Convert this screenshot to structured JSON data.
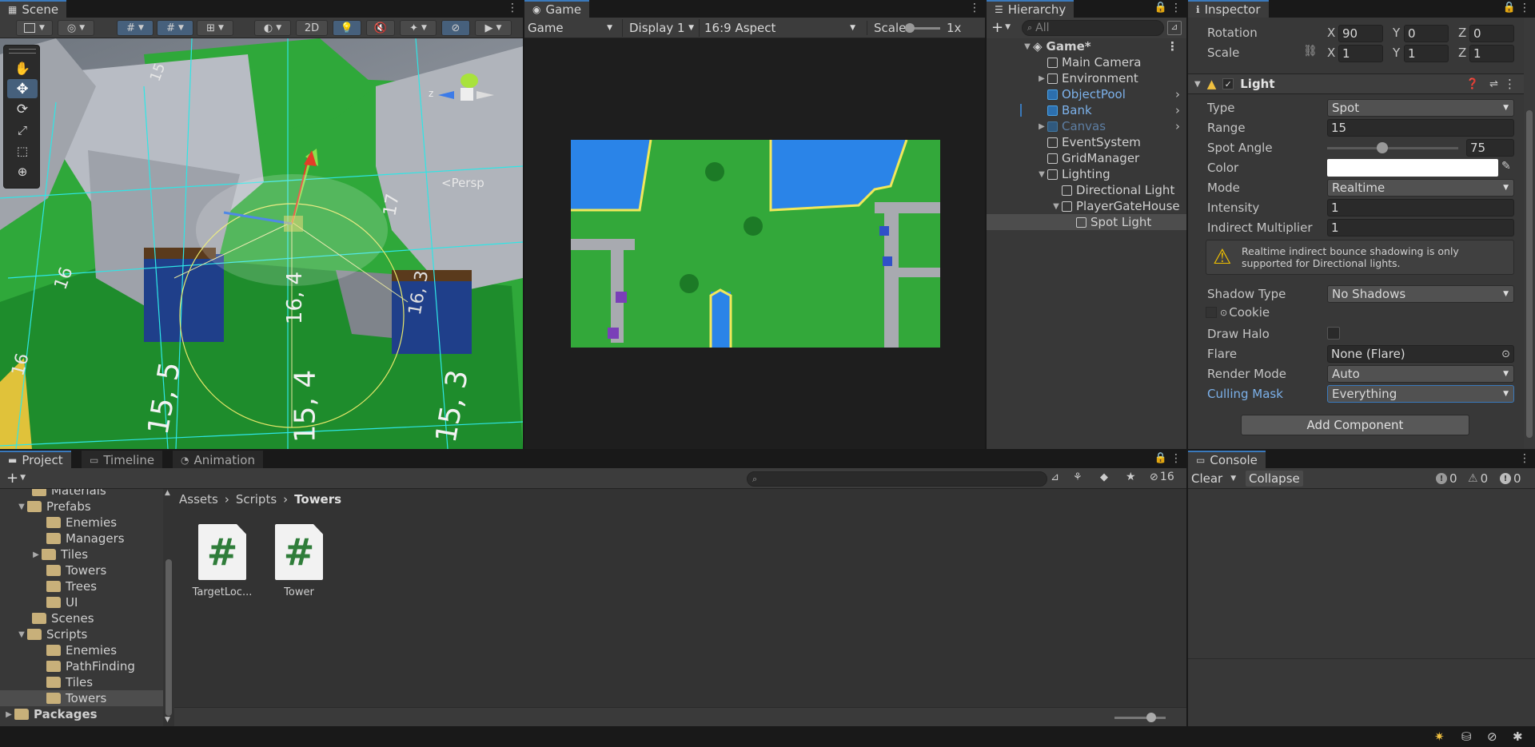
{
  "scene": {
    "tab_label": "Scene",
    "mode_2d": "2D",
    "persp_label": "<Persp",
    "axis_z": "z",
    "grid_labels": [
      "16",
      "16, 4",
      "17",
      "16, 3",
      "15, 5",
      "15, 4",
      "15, 3",
      "15",
      "16"
    ]
  },
  "game": {
    "tab_label": "Game",
    "view_select": "Game",
    "display_select": "Display 1",
    "aspect_select": "16:9 Aspect",
    "scale_label": "Scale",
    "scale_value": "1x"
  },
  "hierarchy": {
    "tab_label": "Hierarchy",
    "search_placeholder": "All",
    "items": [
      {
        "label": "Game*",
        "depth": 0,
        "expanded": true,
        "icon": "unity-scene-icon",
        "bold": true
      },
      {
        "label": "Main Camera",
        "depth": 1,
        "icon": "gameobject-icon"
      },
      {
        "label": "Environment",
        "depth": 1,
        "collapsed": true,
        "icon": "gameobject-icon"
      },
      {
        "label": "ObjectPool",
        "depth": 1,
        "icon": "prefab-icon",
        "prefab": true,
        "arrow": true
      },
      {
        "label": "Bank",
        "depth": 1,
        "icon": "prefab-icon",
        "prefab": true,
        "arrow": true
      },
      {
        "label": "Canvas",
        "depth": 1,
        "collapsed": true,
        "icon": "prefab-icon",
        "prefab": true,
        "dim": true,
        "arrow": true
      },
      {
        "label": "EventSystem",
        "depth": 1,
        "icon": "gameobject-icon"
      },
      {
        "label": "GridManager",
        "depth": 1,
        "icon": "gameobject-icon"
      },
      {
        "label": "Lighting",
        "depth": 1,
        "expanded": true,
        "icon": "gameobject-icon"
      },
      {
        "label": "Directional Light",
        "depth": 2,
        "icon": "gameobject-icon"
      },
      {
        "label": "PlayerGateHouse",
        "depth": 2,
        "expanded": true,
        "icon": "gameobject-icon"
      },
      {
        "label": "Spot Light",
        "depth": 3,
        "icon": "gameobject-icon",
        "selected": true
      }
    ]
  },
  "inspector": {
    "tab_label": "Inspector",
    "rotation_label": "Rotation",
    "rotation": {
      "x": "90",
      "y": "0",
      "z": "0"
    },
    "scale_label": "Scale",
    "scale": {
      "x": "1",
      "y": "1",
      "z": "1"
    },
    "axis_x": "X",
    "axis_y": "Y",
    "axis_z": "Z",
    "component_title": "Light",
    "type_label": "Type",
    "type_value": "Spot",
    "range_label": "Range",
    "range_value": "15",
    "spot_angle_label": "Spot Angle",
    "spot_angle_value": "75",
    "spot_angle_fraction": 0.42,
    "color_label": "Color",
    "color_value": "#ffffff",
    "mode_label": "Mode",
    "mode_value": "Realtime",
    "intensity_label": "Intensity",
    "intensity_value": "1",
    "indirect_label": "Indirect Multiplier",
    "indirect_value": "1",
    "warning_text": "Realtime indirect bounce shadowing is only supported for Directional lights.",
    "shadow_label": "Shadow Type",
    "shadow_value": "No Shadows",
    "cookie_label": "Cookie",
    "halo_label": "Draw Halo",
    "flare_label": "Flare",
    "flare_value": "None (Flare)",
    "render_label": "Render Mode",
    "render_value": "Auto",
    "culling_label": "Culling Mask",
    "culling_value": "Everything",
    "add_component": "Add Component"
  },
  "project": {
    "tab_project": "Project",
    "tab_timeline": "Timeline",
    "tab_animation": "Animation",
    "hidden_count": "16",
    "breadcrumb": [
      "Assets",
      "Scripts",
      "Towers"
    ],
    "tree": [
      {
        "label": "Materials",
        "depth": 1,
        "partial": true
      },
      {
        "label": "Prefabs",
        "depth": 1,
        "expanded": true
      },
      {
        "label": "Enemies",
        "depth": 2
      },
      {
        "label": "Managers",
        "depth": 2
      },
      {
        "label": "Tiles",
        "depth": 2,
        "collapsed": true
      },
      {
        "label": "Towers",
        "depth": 2
      },
      {
        "label": "Trees",
        "depth": 2
      },
      {
        "label": "UI",
        "depth": 2
      },
      {
        "label": "Scenes",
        "depth": 1
      },
      {
        "label": "Scripts",
        "depth": 1,
        "expanded": true
      },
      {
        "label": "Enemies",
        "depth": 2
      },
      {
        "label": "PathFinding",
        "depth": 2
      },
      {
        "label": "Tiles",
        "depth": 2
      },
      {
        "label": "Towers",
        "depth": 2,
        "selected": true
      },
      {
        "label": "Packages",
        "depth": 0,
        "collapsed": true,
        "bold": true
      }
    ],
    "assets": [
      {
        "label": "TargetLoc...",
        "glyph": "#"
      },
      {
        "label": "Tower",
        "glyph": "#"
      }
    ]
  },
  "console": {
    "tab_label": "Console",
    "clear": "Clear",
    "collapse": "Collapse",
    "info_count": "0",
    "warn_count": "0",
    "error_count": "0"
  },
  "colors": {
    "accent": "#3a79bb",
    "prefab_text": "#7cb1ea",
    "panel": "#383838",
    "grass": "#2fa83a",
    "water": "#2a84e8",
    "wall": "#a8aab0"
  }
}
